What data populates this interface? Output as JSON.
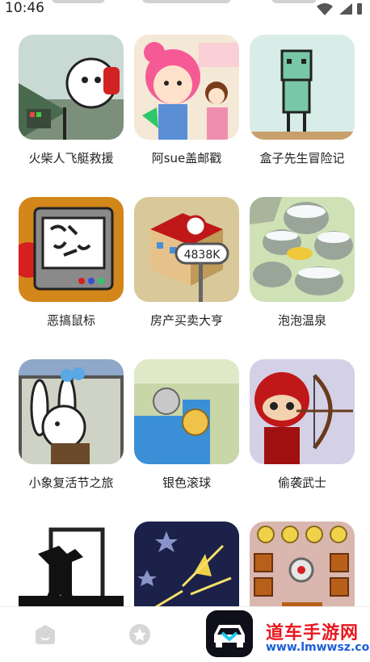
{
  "status_bar": {
    "time": "10:46"
  },
  "games": [
    {
      "title": "火柴人飞艇救援"
    },
    {
      "title": "阿sue盖邮戳"
    },
    {
      "title": "盒子先生冒险记"
    },
    {
      "title": "恶搞鼠标"
    },
    {
      "title": "房产买卖大亨",
      "price_tag": "4838K"
    },
    {
      "title": "泡泡温泉"
    },
    {
      "title": "小象复活节之旅"
    },
    {
      "title": "银色滚球"
    },
    {
      "title": "偷袭武士"
    },
    {
      "title": ""
    },
    {
      "title": ""
    },
    {
      "title": ""
    }
  ],
  "watermark": {
    "title": "道车手游网",
    "url": "www.lmwwsz.com"
  },
  "colors": {
    "accent": "#e8171f",
    "link": "#1b5fd6",
    "nav_icon": "#d6d6d6"
  }
}
